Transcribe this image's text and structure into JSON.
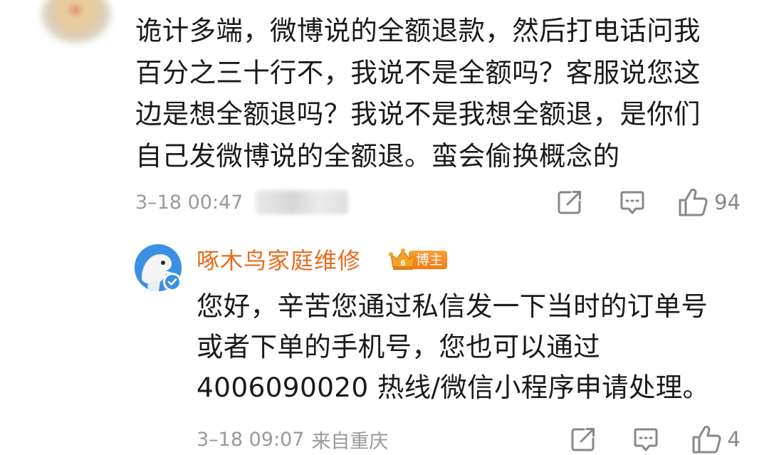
{
  "comment": {
    "text_lines": [
      "诡计多端，微博说的全额退款，然后打电话问我",
      "百分之三十行不，我说不是全额吗？客服说您这",
      "边是想全额退吗？我说不是我想全额退，是你们",
      "自己发微博说的全额退。蛮会偷换概念的"
    ],
    "time": "3–18 00:47",
    "likes": "94"
  },
  "reply": {
    "author": "啄木鸟家庭维修",
    "badge": "博主",
    "badge_level": "6",
    "text_lines": [
      "您好，辛苦您通过私信发一下当时的订单号",
      "或者下单的手机号，您也可以通过",
      "4006090020 热线/微信小程序申请处理。"
    ],
    "time": "3–18 09:07",
    "location": "来自重庆",
    "likes": "4"
  },
  "icons": {
    "share": "share-icon",
    "comment": "comment-icon",
    "like": "thumbs-up-icon",
    "verified": "verified-check-icon"
  },
  "colors": {
    "author_name": "#e86b1d",
    "badge": "#f37b17",
    "meta_text": "#9a9a9a",
    "verified": "#3b90e3"
  }
}
